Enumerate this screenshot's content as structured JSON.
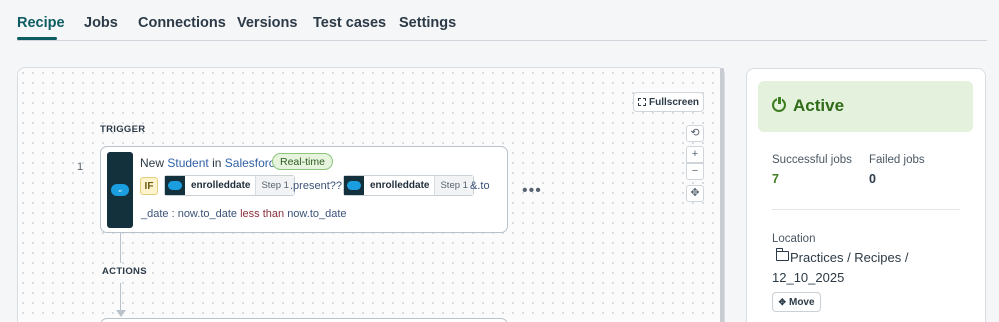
{
  "tabs": [
    {
      "label": "Recipe",
      "active": true
    },
    {
      "label": "Jobs"
    },
    {
      "label": "Connections"
    },
    {
      "label": "Versions"
    },
    {
      "label": "Test cases"
    },
    {
      "label": "Settings"
    }
  ],
  "canvas": {
    "fullscreen_label": "Fullscreen",
    "controls": {
      "reset": "⟲",
      "zoom_in": "+",
      "zoom_out": "−",
      "fit": "✥"
    },
    "trigger_section": "TRIGGER",
    "actions_section": "ACTIONS",
    "trigger": {
      "step_number": "1",
      "title_prefix": "New",
      "object": "Student",
      "title_mid": "in",
      "app": "Salesforce",
      "badge": "Real-time",
      "condition": {
        "if_label": "IF",
        "pill1": {
          "name": "enrolleddate",
          "step": "Step 1"
        },
        "mid_text": ".present??",
        "pill2": {
          "name": "enrolleddate",
          "step": "Step 1"
        },
        "tail_text": "&.to",
        "line2_start": "_date : now.to_date",
        "operator": "less than",
        "line2_end": "now.to_date"
      },
      "more": "•••"
    }
  },
  "panel": {
    "status": "Active",
    "successful_jobs_label": "Successful jobs",
    "successful_jobs_value": "7",
    "failed_jobs_label": "Failed jobs",
    "failed_jobs_value": "0",
    "location_label": "Location",
    "location_path": "Practices / Recipes / 12_10_2025",
    "move_label": "Move"
  },
  "colors": {
    "accent": "#0c5c61",
    "active_bg": "#e4f1dc",
    "active_text": "#2f6b18",
    "success_value": "#3e7d22",
    "failed_value": "#2b3a46"
  },
  "icons": {
    "app_logo": "salesforce-logo",
    "status": "power-icon",
    "location": "folder-icon",
    "move": "move-icon",
    "fullscreen": "expand-icon"
  }
}
